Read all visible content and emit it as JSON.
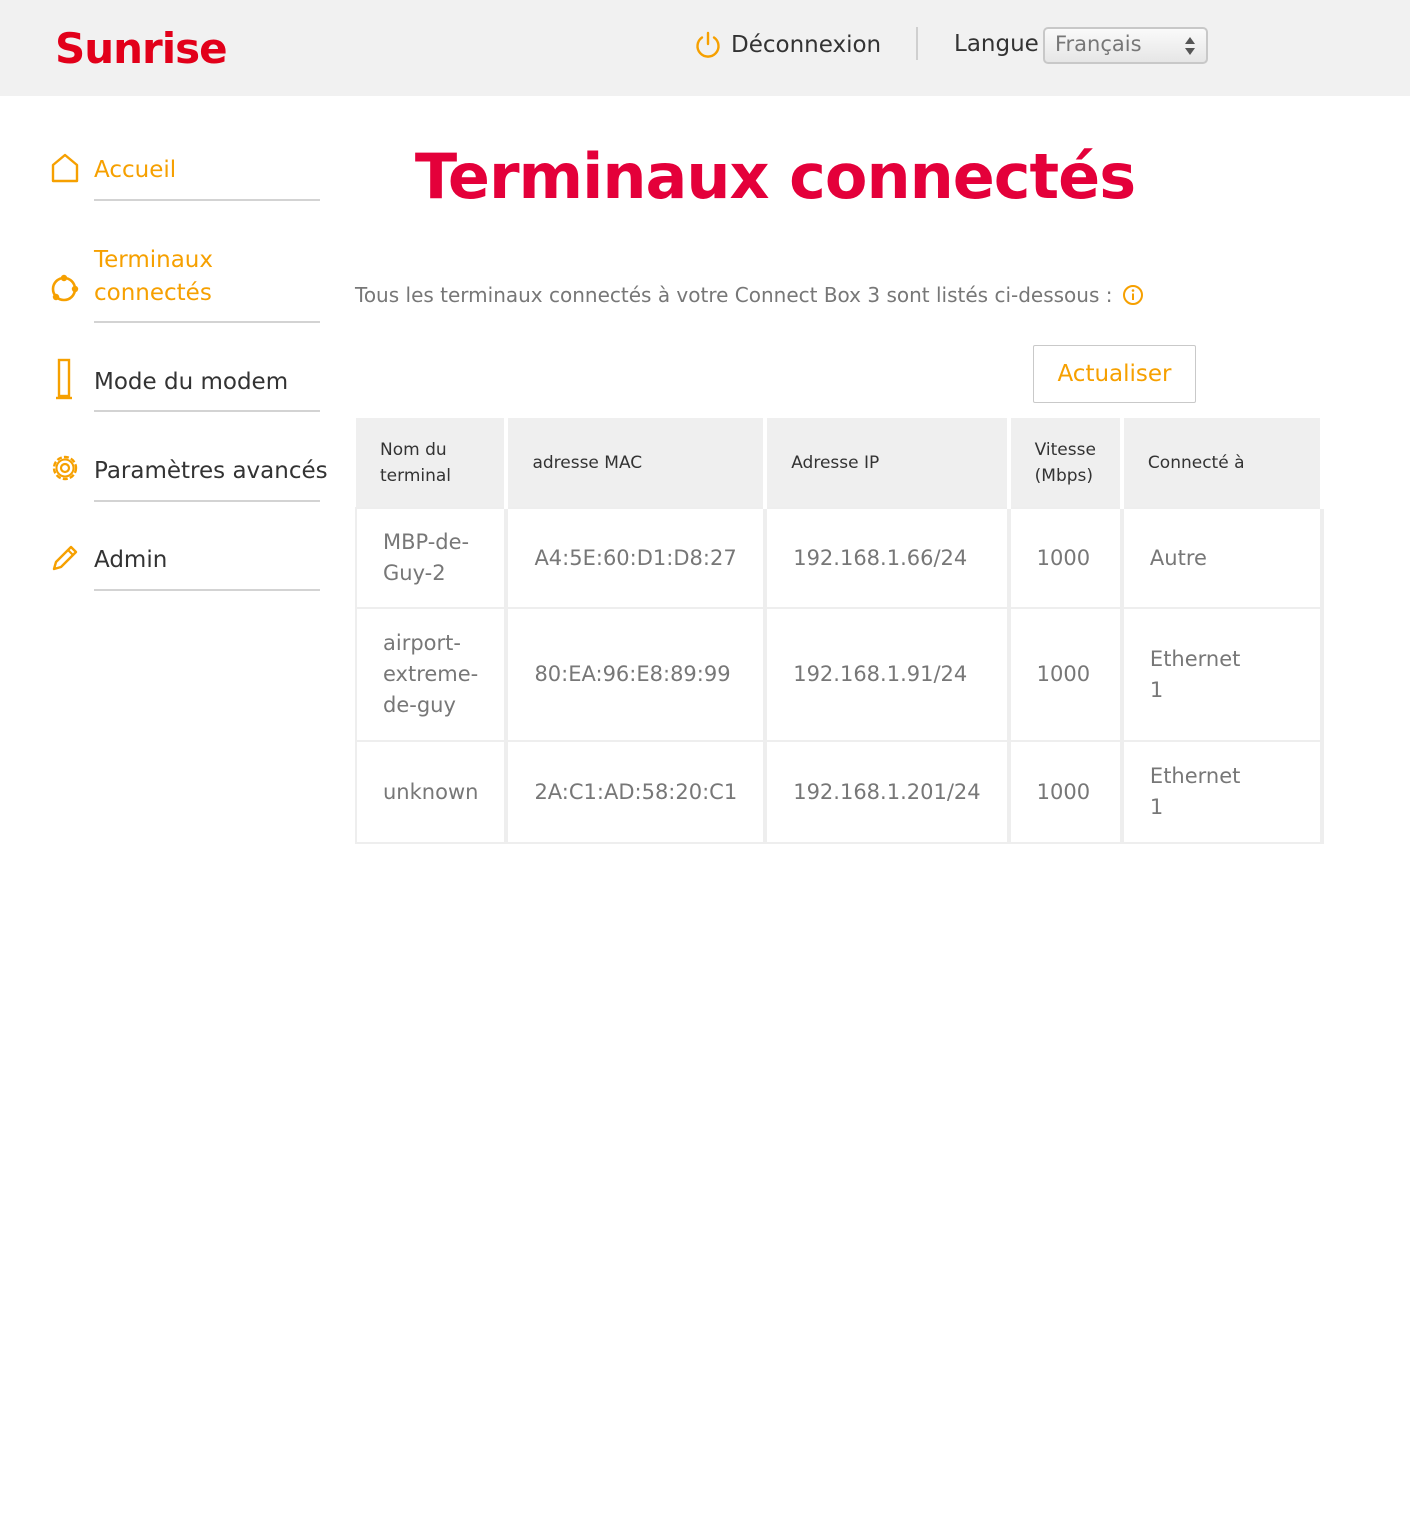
{
  "header": {
    "logo": "Sunrise",
    "logout_label": "Déconnexion",
    "language_label": "Langue",
    "language_selected": "Français"
  },
  "sidebar": {
    "items": [
      {
        "label": "Accueil",
        "icon": "home-icon",
        "active": true
      },
      {
        "label": "Terminaux connectés",
        "icon": "devices-icon",
        "active": true
      },
      {
        "label": "Mode du modem",
        "icon": "modem-icon",
        "active": false
      },
      {
        "label": "Paramètres avancés",
        "icon": "gear-icon",
        "active": false
      },
      {
        "label": "Admin",
        "icon": "pencil-icon",
        "active": false
      }
    ]
  },
  "main": {
    "title": "Terminaux connectés",
    "intro": "Tous les terminaux connectés à votre Connect Box 3 sont listés ci-dessous :",
    "refresh_label": "Actualiser",
    "table": {
      "headers": [
        "Nom du terminal",
        "adresse MAC",
        "Adresse IP",
        "Vitesse (Mbps)",
        "Connecté à"
      ],
      "rows": [
        [
          "MBP-de-Guy-2",
          "A4:5E:60:D1:D8:27",
          "192.168.1.66/24",
          "1000",
          "Autre"
        ],
        [
          "airport-extreme-de-guy",
          "80:EA:96:E8:89:99",
          "192.168.1.91/24",
          "1000",
          "Ethernet 1"
        ],
        [
          "unknown",
          "2A:C1:AD:58:20:C1",
          "192.168.1.201/24",
          "1000",
          "Ethernet 1"
        ]
      ]
    }
  },
  "colors": {
    "brand_red": "#e2001a",
    "title_red": "#e4003a",
    "accent_orange": "#f6a000"
  }
}
